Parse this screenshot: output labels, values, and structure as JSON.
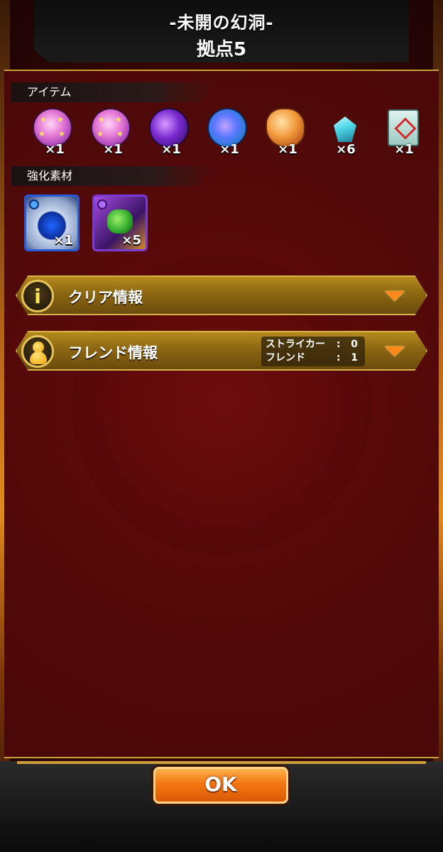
{
  "header": {
    "title": "-未開の幻洞-",
    "subtitle": "拠点5"
  },
  "items_section": {
    "label": "アイテム",
    "items": [
      {
        "icon": "star-orb-icon",
        "count": "×1"
      },
      {
        "icon": "star-orb-icon",
        "count": "×1"
      },
      {
        "icon": "purple-orb-icon",
        "count": "×1"
      },
      {
        "icon": "blue-orb-icon",
        "count": "×1"
      },
      {
        "icon": "orange-stone-icon",
        "count": "×1"
      },
      {
        "icon": "cyan-gem-icon",
        "count": "×6"
      },
      {
        "icon": "scroll-icon",
        "count": "×1"
      }
    ]
  },
  "materials_section": {
    "label": "強化素材",
    "materials": [
      {
        "icon": "blue-material-icon",
        "count": "×1"
      },
      {
        "icon": "green-material-icon",
        "count": "×5"
      }
    ]
  },
  "clear_info": {
    "label": "クリア情報",
    "icon": "info-icon"
  },
  "friend_info": {
    "label": "フレンド情報",
    "icon": "person-icon",
    "striker_label": "ストライカー",
    "striker_value": "0",
    "friend_label": "フレンド",
    "friend_value": "1",
    "separator": ":"
  },
  "ok_button": {
    "label": "OK"
  },
  "colors": {
    "panel_red": "#5c0a0a",
    "gold_border": "#c9a03a",
    "ok_orange": "#f47612",
    "chevron_orange": "#ff8a1a"
  }
}
